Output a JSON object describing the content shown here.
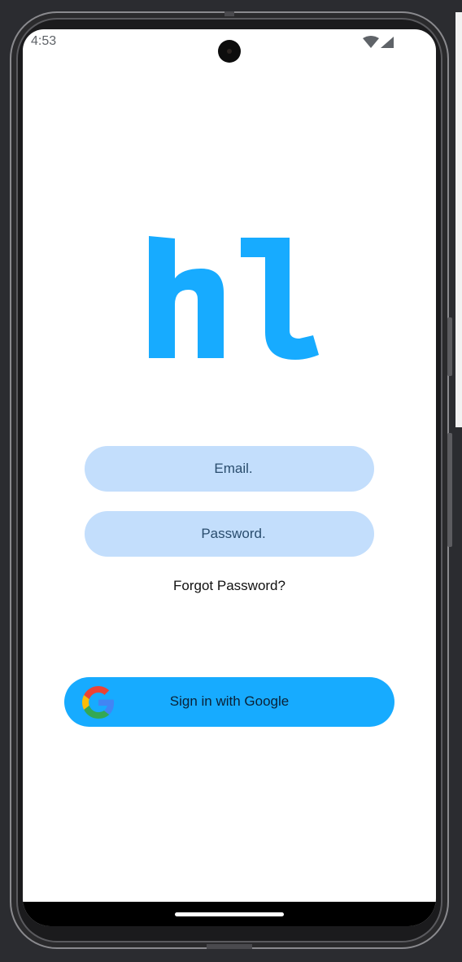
{
  "status_bar": {
    "time": "4:53",
    "icons": [
      "wifi-icon",
      "cellular-signal-icon"
    ]
  },
  "logo": {
    "text": "hl",
    "color": "#17abff"
  },
  "login_form": {
    "email_placeholder": "Email.",
    "password_placeholder": "Password.",
    "field_color": "#c3defc",
    "forgot_password_label": "Forgot Password?"
  },
  "google_sign_in": {
    "label": "Sign in with Google",
    "icon": "google-g-icon",
    "color": "#17abff"
  },
  "navigation_bar": {
    "handle": "gesture-handle"
  }
}
